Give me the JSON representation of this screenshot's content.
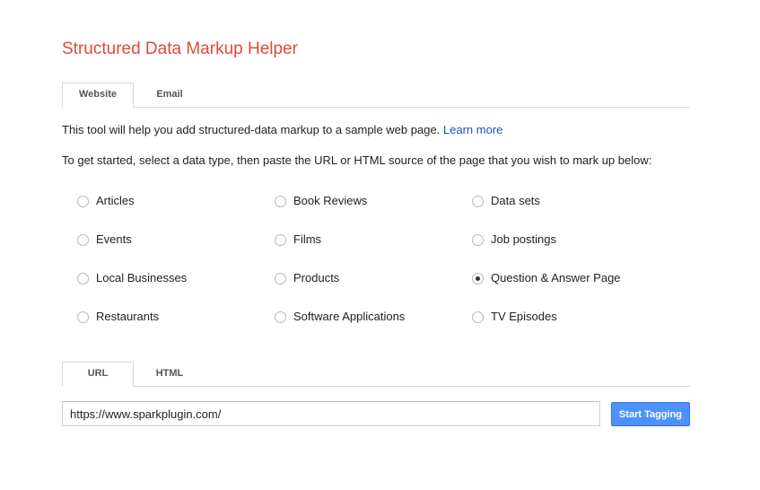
{
  "header": {
    "title": "Structured Data Markup Helper"
  },
  "source_tabs": [
    {
      "label": "Website",
      "active": true
    },
    {
      "label": "Email",
      "active": false
    }
  ],
  "intro": {
    "text": "This tool will help you add structured-data markup to a sample web page. ",
    "link_label": "Learn more"
  },
  "instructions": "To get started, select a data type, then paste the URL or HTML source of the page that you wish to mark up below:",
  "data_types": [
    {
      "label": "Articles",
      "checked": false
    },
    {
      "label": "Book Reviews",
      "checked": false
    },
    {
      "label": "Data sets",
      "checked": false
    },
    {
      "label": "Events",
      "checked": false
    },
    {
      "label": "Films",
      "checked": false
    },
    {
      "label": "Job postings",
      "checked": false
    },
    {
      "label": "Local Businesses",
      "checked": false
    },
    {
      "label": "Products",
      "checked": false
    },
    {
      "label": "Question & Answer Page",
      "checked": true
    },
    {
      "label": "Restaurants",
      "checked": false
    },
    {
      "label": "Software Applications",
      "checked": false
    },
    {
      "label": "TV Episodes",
      "checked": false
    }
  ],
  "input_tabs": [
    {
      "label": "URL",
      "active": true
    },
    {
      "label": "HTML",
      "active": false
    }
  ],
  "url_field": {
    "value": "https://www.sparkplugin.com/"
  },
  "start_button": {
    "label": "Start Tagging"
  },
  "colors": {
    "title": "#dd4b39",
    "link": "#1155cc",
    "primary_button": "#4d90fe"
  }
}
